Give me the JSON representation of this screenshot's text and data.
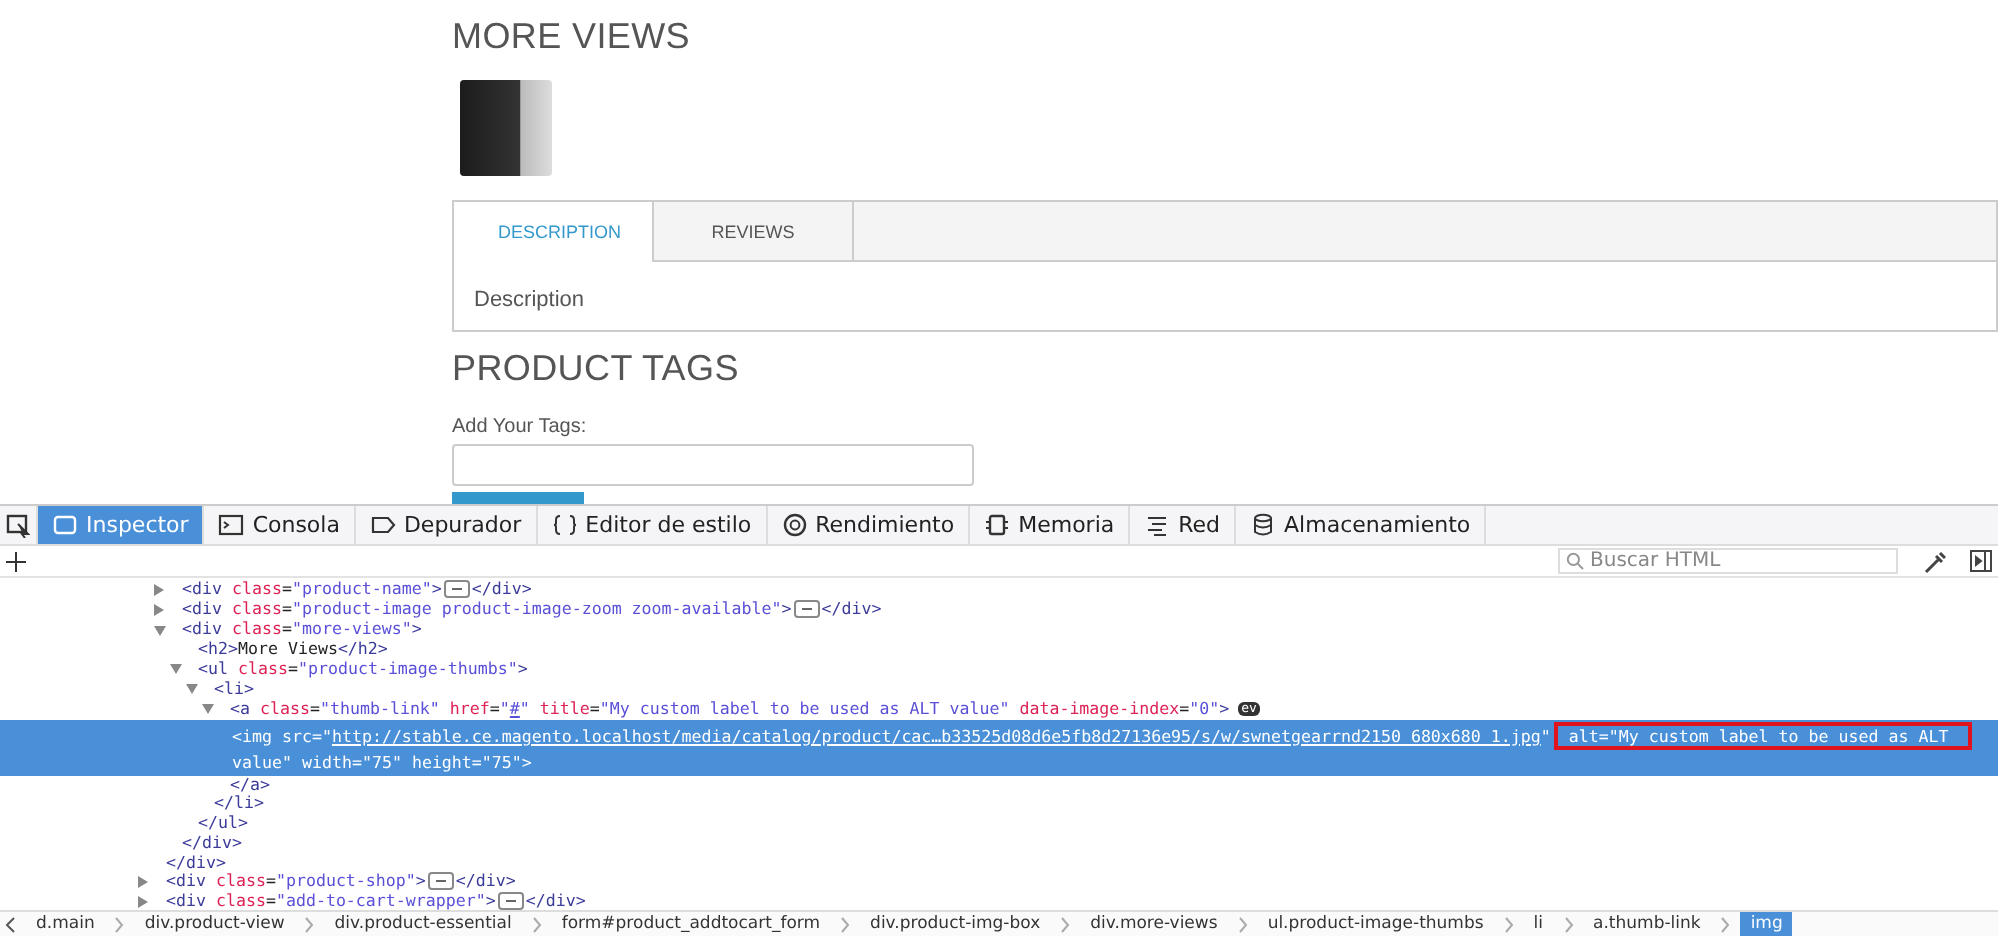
{
  "page": {
    "more_views_heading": "MORE VIEWS",
    "tabs": [
      {
        "label": "DESCRIPTION",
        "selected": true
      },
      {
        "label": "REVIEWS",
        "selected": false
      }
    ],
    "tab_content": "Description",
    "tags_heading": "PRODUCT TAGS",
    "tags_label": "Add Your Tags:"
  },
  "devtools": {
    "tabs": [
      {
        "label": "Inspector",
        "selected": true
      },
      {
        "label": "Consola",
        "selected": false
      },
      {
        "label": "Depurador",
        "selected": false
      },
      {
        "label": "Editor de estilo",
        "selected": false
      },
      {
        "label": "Rendimiento",
        "selected": false
      },
      {
        "label": "Memoria",
        "selected": false
      },
      {
        "label": "Red",
        "selected": false
      },
      {
        "label": "Almacenamiento",
        "selected": false
      }
    ],
    "search": {
      "placeholder": "Buscar HTML"
    },
    "markup": [
      {
        "children": [
          {
            "selected": false,
            "expanded": false,
            "tokens": [
              {
                "kind": "tag",
                "text": "<div"
              },
              {
                "kind": "attr",
                "text": " class"
              },
              {
                "kind": "plain",
                "text": "="
              },
              {
                "kind": "value",
                "text": "\"product-name\""
              },
              {
                "kind": "tag",
                "text": ">"
              },
              {
                "kind": "ellipsis"
              },
              {
                "kind": "tag",
                "text": "</div>"
              }
            ]
          },
          {
            "selected": false,
            "expanded": false,
            "tokens": [
              {
                "kind": "tag",
                "text": "<div"
              },
              {
                "kind": "attr",
                "text": " class"
              },
              {
                "kind": "plain",
                "text": "="
              },
              {
                "kind": "value",
                "text": "\"product-image product-image-zoom zoom-available\""
              },
              {
                "kind": "tag",
                "text": ">"
              },
              {
                "kind": "ellipsis"
              },
              {
                "kind": "tag",
                "text": "</div>"
              }
            ]
          },
          {
            "selected": false,
            "expanded": true,
            "tokens": [
              {
                "kind": "tag",
                "text": "<div"
              },
              {
                "kind": "attr",
                "text": " class"
              },
              {
                "kind": "plain",
                "text": "="
              },
              {
                "kind": "value",
                "text": "\"more-views\""
              },
              {
                "kind": "tag",
                "text": ">"
              }
            ],
            "close": [
              {
                "kind": "tag",
                "text": "</div>"
              }
            ],
            "children": [
              {
                "selected": false,
                "tokens": [
                  {
                    "kind": "tag",
                    "text": "<h2>"
                  },
                  {
                    "kind": "plain",
                    "text": "More Views"
                  },
                  {
                    "kind": "tag",
                    "text": "</h2>"
                  }
                ]
              },
              {
                "selected": false,
                "expanded": true,
                "tokens": [
                  {
                    "kind": "tag",
                    "text": "<ul"
                  },
                  {
                    "kind": "attr",
                    "text": " class"
                  },
                  {
                    "kind": "plain",
                    "text": "="
                  },
                  {
                    "kind": "value",
                    "text": "\"product-image-thumbs\""
                  },
                  {
                    "kind": "tag",
                    "text": ">"
                  }
                ],
                "close": [
                  {
                    "kind": "tag",
                    "text": "</ul>"
                  }
                ],
                "children": [
                  {
                    "selected": false,
                    "expanded": true,
                    "tokens": [
                      {
                        "kind": "tag",
                        "text": "<li>"
                      }
                    ],
                    "close": [
                      {
                        "kind": "tag",
                        "text": "</li>"
                      }
                    ],
                    "children": [
                      {
                        "selected": false,
                        "expanded": true,
                        "tokens": [
                          {
                            "kind": "tag",
                            "text": "<a"
                          },
                          {
                            "kind": "attr",
                            "text": " class"
                          },
                          {
                            "kind": "plain",
                            "text": "="
                          },
                          {
                            "kind": "value",
                            "text": "\"thumb-link\""
                          },
                          {
                            "kind": "attr",
                            "text": " href"
                          },
                          {
                            "kind": "plain",
                            "text": "="
                          },
                          {
                            "kind": "value",
                            "text": "\""
                          },
                          {
                            "kind": "link",
                            "text": "#"
                          },
                          {
                            "kind": "value",
                            "text": "\""
                          },
                          {
                            "kind": "attr",
                            "text": " title"
                          },
                          {
                            "kind": "plain",
                            "text": "="
                          },
                          {
                            "kind": "value",
                            "text": "\"My custom label to be used as ALT value\""
                          },
                          {
                            "kind": "attr",
                            "text": " data-image-index"
                          },
                          {
                            "kind": "plain",
                            "text": "="
                          },
                          {
                            "kind": "value",
                            "text": "\"0\""
                          },
                          {
                            "kind": "tag",
                            "text": ">"
                          },
                          {
                            "kind": "badge",
                            "text": "ev"
                          }
                        ],
                        "close": [
                          {
                            "kind": "tag",
                            "text": "</a>"
                          }
                        ],
                        "children": [
                          {
                            "selected": true,
                            "tokens": [
                              {
                                "kind": "tag",
                                "text": "<img"
                              },
                              {
                                "kind": "attr",
                                "text": " src"
                              },
                              {
                                "kind": "plain",
                                "text": "="
                              },
                              {
                                "kind": "value",
                                "text": "\""
                              },
                              {
                                "kind": "link",
                                "text": "http://stable.ce.magento.localhost/media/catalog/product/cac…b33525d08d6e5fb8d27136e95/s/w/swnetgearrnd2150_680x680_1.jpg"
                              },
                              {
                                "kind": "value",
                                "text": "\""
                              },
                              {
                                "kind": "attr",
                                "text": "alt=\"My custom label to be used as ALT",
                                "boxed": true
                              },
                              {
                                "kind": "value",
                                "text": " value\""
                              },
                              {
                                "kind": "attr",
                                "text": " width"
                              },
                              {
                                "kind": "plain",
                                "text": "="
                              },
                              {
                                "kind": "value",
                                "text": "\"75\""
                              },
                              {
                                "kind": "attr",
                                "text": " height"
                              },
                              {
                                "kind": "plain",
                                "text": "="
                              },
                              {
                                "kind": "value",
                                "text": "\"75\""
                              },
                              {
                                "kind": "tag",
                                "text": ">"
                              }
                            ]
                          }
                        ]
                      }
                    ]
                  }
                ]
              }
            ]
          }
        ],
        "close": [
          {
            "kind": "tag",
            "text": "</div>"
          }
        ]
      },
      {
        "selected": false,
        "expanded": false,
        "tokens": [
          {
            "kind": "tag",
            "text": "<div"
          },
          {
            "kind": "attr",
            "text": " class"
          },
          {
            "kind": "plain",
            "text": "="
          },
          {
            "kind": "value",
            "text": "\"product-shop\""
          },
          {
            "kind": "tag",
            "text": ">"
          },
          {
            "kind": "ellipsis"
          },
          {
            "kind": "tag",
            "text": "</div>"
          }
        ]
      },
      {
        "selected": false,
        "expanded": false,
        "tokens": [
          {
            "kind": "tag",
            "text": "<div"
          },
          {
            "kind": "attr",
            "text": " class"
          },
          {
            "kind": "plain",
            "text": "="
          },
          {
            "kind": "value",
            "text": "\"add-to-cart-wrapper\""
          },
          {
            "kind": "tag",
            "text": ">"
          },
          {
            "kind": "ellipsis"
          },
          {
            "kind": "tag",
            "text": "</div>"
          }
        ]
      }
    ],
    "breadcrumbs": [
      {
        "label": "d.main",
        "selected": false
      },
      {
        "label": "div.product-view",
        "selected": false
      },
      {
        "label": "div.product-essential",
        "selected": false
      },
      {
        "label": "form#product_addtocart_form",
        "selected": false
      },
      {
        "label": "div.product-img-box",
        "selected": false
      },
      {
        "label": "div.more-views",
        "selected": false
      },
      {
        "label": "ul.product-image-thumbs",
        "selected": false
      },
      {
        "label": "li",
        "selected": false
      },
      {
        "label": "a.thumb-link",
        "selected": false
      },
      {
        "label": "img",
        "selected": true
      }
    ]
  }
}
